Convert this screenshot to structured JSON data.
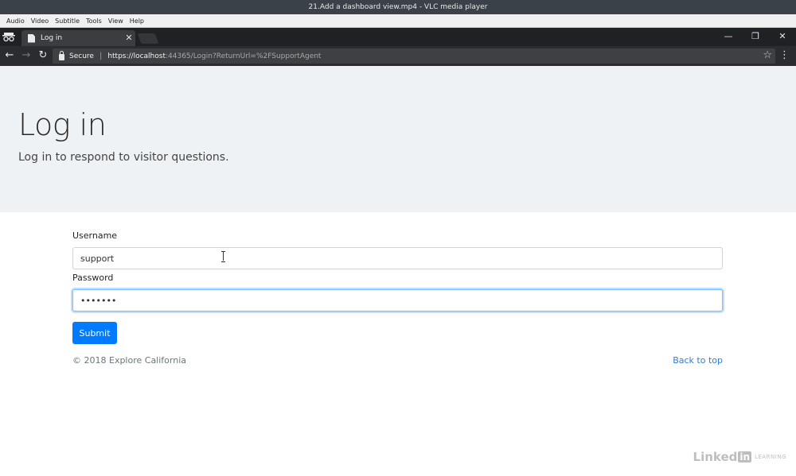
{
  "vlc": {
    "title": "21.Add a dashboard view.mp4 - VLC media player",
    "menu": [
      "Audio",
      "Video",
      "Subtitle",
      "Tools",
      "View",
      "Help"
    ]
  },
  "browser": {
    "tab_title": "Log in",
    "tab_close": "✕",
    "window_controls": {
      "minimize": "—",
      "restore": "❐",
      "close": "✕"
    },
    "nav": {
      "back": "←",
      "forward": "→",
      "reload": "↻"
    },
    "secure_label": "Secure",
    "separator": "|",
    "url_host": "https://localhost",
    "url_rest": ":44365/Login?ReturnUrl=%2FSupportAgent",
    "star": "☆",
    "menu": "⋮"
  },
  "page": {
    "title": "Log in",
    "lead": "Log in to respond to visitor questions.",
    "form": {
      "username_label": "Username",
      "username_value": "support",
      "password_label": "Password",
      "password_value": "•••••••",
      "submit_label": "Submit"
    },
    "footer": {
      "copyright": "© 2018 Explore California",
      "back_to_top": "Back to top"
    }
  },
  "watermark": {
    "linked": "Linked",
    "in": "in",
    "learning": "LEARNING"
  }
}
